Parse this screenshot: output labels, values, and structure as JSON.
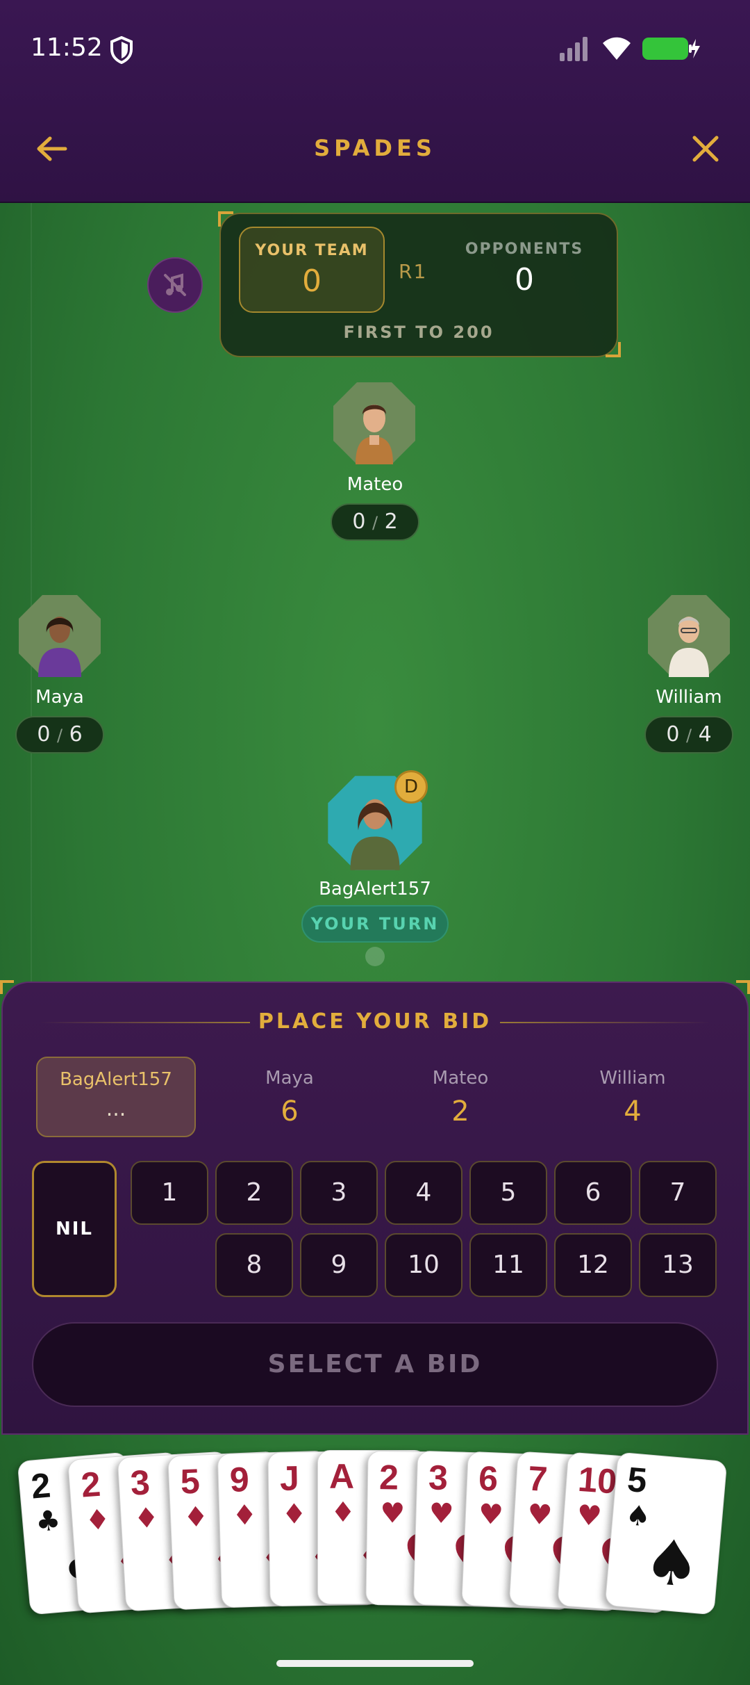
{
  "status": {
    "time": "11:52"
  },
  "header": {
    "title": "SPADES"
  },
  "score": {
    "your_team_label": "YOUR TEAM",
    "your_team_score": "0",
    "round": "R1",
    "opponents_label": "OPPONENTS",
    "opponents_score": "0",
    "goal": "FIRST TO 200"
  },
  "players": {
    "top": {
      "name": "Mateo",
      "tricks": "0",
      "bid": "2"
    },
    "left": {
      "name": "Maya",
      "tricks": "0",
      "bid": "6"
    },
    "right": {
      "name": "William",
      "tricks": "0",
      "bid": "4"
    },
    "me": {
      "name": "BagAlert157",
      "dealer_badge": "D",
      "turn_label": "YOUR TURN"
    }
  },
  "bid_panel": {
    "title": "PLACE YOUR BID",
    "bidders": [
      {
        "name": "BagAlert157",
        "bid": "..."
      },
      {
        "name": "Maya",
        "bid": "6"
      },
      {
        "name": "Mateo",
        "bid": "2"
      },
      {
        "name": "William",
        "bid": "4"
      }
    ],
    "nil_label": "NIL",
    "options": [
      "1",
      "2",
      "3",
      "4",
      "5",
      "6",
      "7",
      "8",
      "9",
      "10",
      "11",
      "12",
      "13"
    ],
    "submit_label": "SELECT A BID"
  },
  "hand": [
    {
      "rank": "2",
      "suit": "♣",
      "color": "#111111"
    },
    {
      "rank": "2",
      "suit": "♦",
      "color": "#a3203a"
    },
    {
      "rank": "3",
      "suit": "♦",
      "color": "#a3203a"
    },
    {
      "rank": "5",
      "suit": "♦",
      "color": "#a3203a"
    },
    {
      "rank": "9",
      "suit": "♦",
      "color": "#a3203a"
    },
    {
      "rank": "J",
      "suit": "♦",
      "color": "#a3203a"
    },
    {
      "rank": "A",
      "suit": "♦",
      "color": "#a3203a"
    },
    {
      "rank": "2",
      "suit": "♥",
      "color": "#a3203a"
    },
    {
      "rank": "3",
      "suit": "♥",
      "color": "#a3203a"
    },
    {
      "rank": "6",
      "suit": "♥",
      "color": "#a3203a"
    },
    {
      "rank": "7",
      "suit": "♥",
      "color": "#a3203a"
    },
    {
      "rank": "10",
      "suit": "♥",
      "color": "#a3203a"
    },
    {
      "rank": "5",
      "suit": "♠",
      "color": "#111111"
    }
  ],
  "colors": {
    "accent": "#e2ad3c",
    "panel": "#3d1a4e",
    "felt": "#2e7a36",
    "turn": "#58d3b0"
  }
}
